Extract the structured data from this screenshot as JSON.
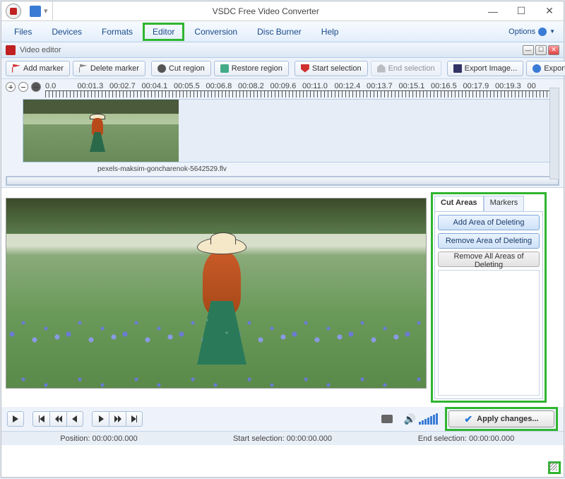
{
  "window": {
    "title": "VSDC Free Video Converter"
  },
  "menubar": {
    "items": [
      "Files",
      "Devices",
      "Formats",
      "Editor",
      "Conversion",
      "Disc Burner",
      "Help"
    ],
    "highlighted_index": 3,
    "options_label": "Options"
  },
  "subwindow": {
    "title": "Video editor"
  },
  "toolbar": {
    "add_marker": "Add marker",
    "delete_marker": "Delete marker",
    "cut_region": "Cut region",
    "restore_region": "Restore region",
    "start_selection": "Start selection",
    "end_selection": "End selection",
    "export_image": "Export Image...",
    "export_audio": "Export Audio..."
  },
  "timeline": {
    "labels": [
      "0.0",
      "00:01.3",
      "00:02.7",
      "00:04.1",
      "00:05.5",
      "00:06.8",
      "00:08.2",
      "00:09.6",
      "00:11.0",
      "00:12.4",
      "00:13.7",
      "00:15.1",
      "00:16.5",
      "00:17.9",
      "00:19.3",
      "00"
    ],
    "filename": "pexels-maksim-goncharenok-5642529.flv"
  },
  "side_panel": {
    "tabs": {
      "cut_areas": "Cut Areas",
      "markers": "Markers",
      "active": "cut_areas"
    },
    "add_area": "Add Area of Deleting",
    "remove_area": "Remove Area of Deleting",
    "remove_all": "Remove All Areas of Deleting"
  },
  "apply": {
    "label": "Apply changes..."
  },
  "status": {
    "position_label": "Position:",
    "position_value": "00:00:00.000",
    "start_label": "Start selection:",
    "start_value": "00:00:00.000",
    "end_label": "End selection:",
    "end_value": "00:00:00.000"
  }
}
